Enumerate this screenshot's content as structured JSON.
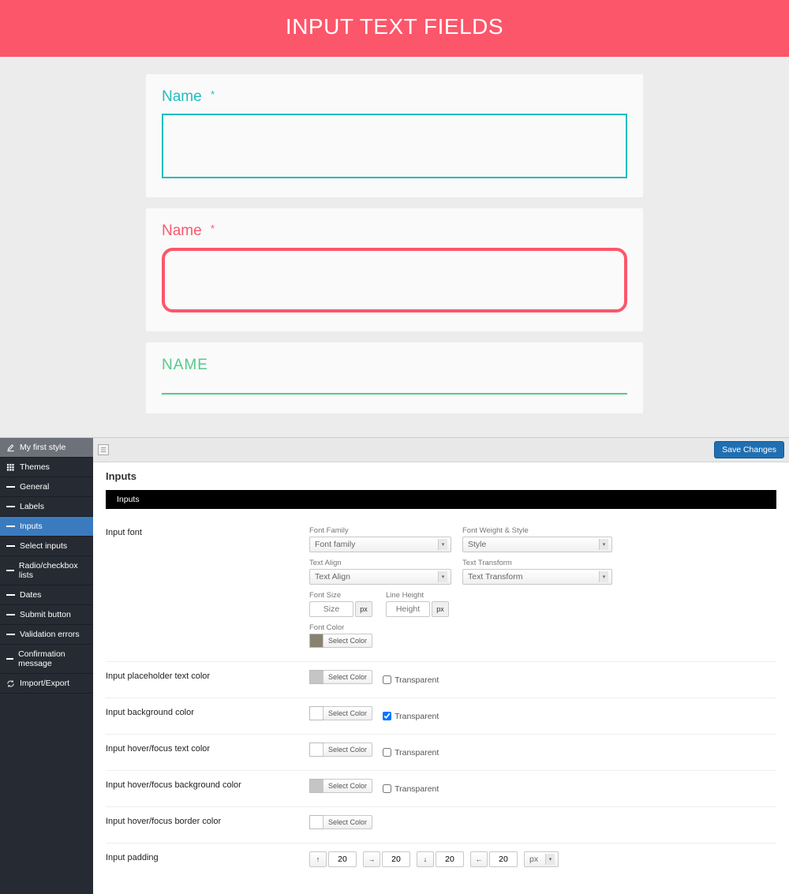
{
  "preview": {
    "header_title": "INPUT TEXT FIELDS",
    "field1_label": "Name",
    "field1_star": "*",
    "field2_label": "Name",
    "field2_star": "*",
    "field3_label": "NAME"
  },
  "sidebar": {
    "items": [
      {
        "label": "My first style",
        "icon": "edit"
      },
      {
        "label": "Themes",
        "icon": "grid"
      },
      {
        "label": "General",
        "icon": "dash"
      },
      {
        "label": "Labels",
        "icon": "dash"
      },
      {
        "label": "Inputs",
        "icon": "dash"
      },
      {
        "label": "Select inputs",
        "icon": "dash"
      },
      {
        "label": "Radio/checkbox lists",
        "icon": "dash"
      },
      {
        "label": "Dates",
        "icon": "dash"
      },
      {
        "label": "Submit button",
        "icon": "dash"
      },
      {
        "label": "Validation errors",
        "icon": "dash"
      },
      {
        "label": "Confirmation message",
        "icon": "dash"
      },
      {
        "label": "Import/Export",
        "icon": "refresh"
      }
    ]
  },
  "topbar": {
    "save": "Save Changes"
  },
  "panel": {
    "title": "Inputs",
    "tab": "Inputs",
    "font": {
      "row_label": "Input font",
      "family_label": "Font Family",
      "family_value": "Font family",
      "weight_label": "Font Weight & Style",
      "weight_value": "Style",
      "align_label": "Text Align",
      "align_value": "Text Align",
      "transform_label": "Text Transform",
      "transform_value": "Text Transform",
      "size_label": "Font Size",
      "size_placeholder": "Size",
      "lh_label": "Line Height",
      "lh_placeholder": "Height",
      "unit": "px",
      "color_label": "Font Color",
      "select_color": "Select Color"
    },
    "placeholder_row": {
      "label": "Input placeholder text color",
      "select_color": "Select Color",
      "transparent": "Transparent"
    },
    "bg_row": {
      "label": "Input background color",
      "select_color": "Select Color",
      "transparent": "Transparent"
    },
    "hover_text_row": {
      "label": "Input hover/focus text color",
      "select_color": "Select Color",
      "transparent": "Transparent"
    },
    "hover_bg_row": {
      "label": "Input hover/focus background color",
      "select_color": "Select Color",
      "transparent": "Transparent"
    },
    "hover_border_row": {
      "label": "Input hover/focus border color",
      "select_color": "Select Color"
    },
    "padding_row": {
      "label": "Input padding",
      "top": "20",
      "right": "20",
      "bottom": "20",
      "left": "20",
      "unit": "px"
    }
  }
}
